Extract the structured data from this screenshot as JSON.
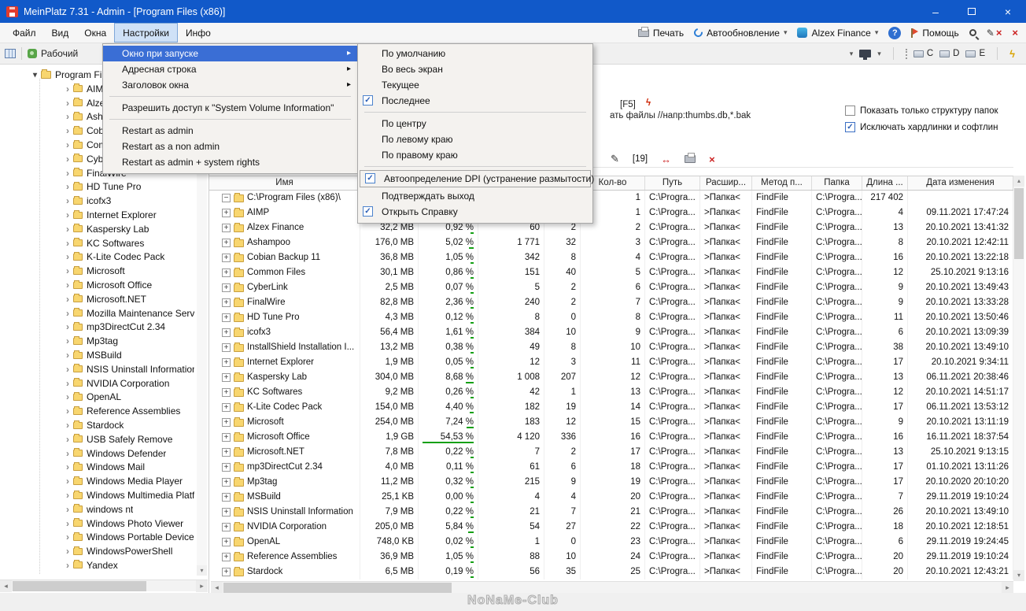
{
  "window": {
    "title": "MeinPlatz 7.31 - Admin - [Program Files (x86)]",
    "controls": {
      "minimize": "–",
      "close": "×"
    }
  },
  "menubar": {
    "items": [
      "Файл",
      "Вид",
      "Окна",
      "Настройки",
      "Инфо"
    ],
    "active": "Настройки",
    "right": {
      "print": "Печать",
      "autoupdate": "Автообновление",
      "alzex": "Alzex Finance",
      "help_mark": "?",
      "help": "Помощь"
    }
  },
  "toolbar2": {
    "workspace": "Рабочий",
    "drives": [
      "C",
      "D",
      "E"
    ]
  },
  "settings_menu": {
    "items": [
      {
        "label": "Окно при запуске",
        "arrow": true,
        "highlighted": true
      },
      {
        "label": "Адресная строка",
        "arrow": true
      },
      {
        "label": "Заголовок окна",
        "arrow": true
      },
      {
        "sep": true
      },
      {
        "label": "Разрешить доступ к \"System Volume Information\""
      },
      {
        "sep": true
      },
      {
        "label": "Restart as admin"
      },
      {
        "label": "Restart as a non admin"
      },
      {
        "label": "Restart as admin + system rights"
      }
    ]
  },
  "startup_submenu": {
    "items": [
      {
        "label": "По умолчанию"
      },
      {
        "label": "Во весь экран"
      },
      {
        "label": "Текущее"
      },
      {
        "label": "Последнее",
        "checked": true
      },
      {
        "sep": true
      },
      {
        "label": "По центру"
      },
      {
        "label": "По левому  краю"
      },
      {
        "label": "По правому  краю"
      },
      {
        "sep": true
      },
      {
        "label": "Автоопределение DPI (устранение размытости)",
        "checked": true,
        "boxed": true
      },
      {
        "label": "Подтверждать выход"
      },
      {
        "label": "Открыть Справку",
        "checked": true
      }
    ]
  },
  "sidebar": {
    "root": "Program Files (x86)",
    "items": [
      "AIMP",
      "Alzex Finance",
      "Ashampoo",
      "Cobian Backup 11",
      "Common Files",
      "CyberLink",
      "FinalWire",
      "HD Tune Pro",
      "icofx3",
      "Internet Explorer",
      "Kaspersky Lab",
      "KC Softwares",
      "K-Lite Codec Pack",
      "Microsoft",
      "Microsoft Office",
      "Microsoft.NET",
      "Mozilla Maintenance Servic",
      "mp3DirectCut 2.34",
      "Mp3tag",
      "MSBuild",
      "NSIS Uninstall Information",
      "NVIDIA Corporation",
      "OpenAL",
      "Reference Assemblies",
      "Stardock",
      "USB Safely Remove",
      "Windows Defender",
      "Windows Mail",
      "Windows Media Player",
      "Windows Multimedia Platfo",
      "windows nt",
      "Windows Photo Viewer",
      "Windows Portable Devices",
      "WindowsPowerShell",
      "Yandex"
    ]
  },
  "options_panel": {
    "refresh_hint": "[F5]",
    "exclude_hint": "ать файлы //напр:thumbs.db,*.bak",
    "checkboxes": [
      {
        "label": "Показать только структуру папок",
        "checked": false
      },
      {
        "label": "Исключать хардлинки и софтлин",
        "checked": true
      }
    ]
  },
  "table_toolbar": {
    "badge": "[19]"
  },
  "table": {
    "headers": [
      "Имя",
      "",
      "",
      "",
      "",
      "Кол-во",
      "Путь",
      "Расшир...",
      "Метод п...",
      "Папка",
      "Длина ...",
      "Дата изменения"
    ],
    "rows": [
      {
        "name": "C:\\Program Files (x86)\\",
        "root": true,
        "size": "",
        "pct": "",
        "files": "",
        "folders": "",
        "num": "1",
        "path": "C:\\Progra...",
        "ext": ">Папка<",
        "method": "FindFile",
        "folder": "C:\\Progra...",
        "len": "217 402",
        "date": ""
      },
      {
        "name": "AIMP",
        "size": "",
        "pct": "",
        "files": "",
        "folders": "",
        "num": "1",
        "path": "C:\\Progra...",
        "ext": ">Папка<",
        "method": "FindFile",
        "folder": "C:\\Progra...",
        "len": "4",
        "date": "09.11.2021 17:47:24"
      },
      {
        "name": "Alzex Finance",
        "size": "32,2 MB",
        "pct": "0,92 %",
        "files": "60",
        "folders": "2",
        "num": "2",
        "path": "C:\\Progra...",
        "ext": ">Папка<",
        "method": "FindFile",
        "folder": "C:\\Progra...",
        "len": "13",
        "date": "20.10.2021 13:41:32"
      },
      {
        "name": "Ashampoo",
        "size": "176,0 MB",
        "pct": "5,02 %",
        "files": "1 771",
        "folders": "32",
        "num": "3",
        "path": "C:\\Progra...",
        "ext": ">Папка<",
        "method": "FindFile",
        "folder": "C:\\Progra...",
        "len": "8",
        "date": "20.10.2021 12:42:11"
      },
      {
        "name": "Cobian Backup 11",
        "size": "36,8 MB",
        "pct": "1,05 %",
        "files": "342",
        "folders": "8",
        "num": "4",
        "path": "C:\\Progra...",
        "ext": ">Папка<",
        "method": "FindFile",
        "folder": "C:\\Progra...",
        "len": "16",
        "date": "20.10.2021 13:22:18"
      },
      {
        "name": "Common Files",
        "size": "30,1 MB",
        "pct": "0,86 %",
        "files": "151",
        "folders": "40",
        "num": "5",
        "path": "C:\\Progra...",
        "ext": ">Папка<",
        "method": "FindFile",
        "folder": "C:\\Progra...",
        "len": "12",
        "date": "25.10.2021 9:13:16"
      },
      {
        "name": "CyberLink",
        "size": "2,5 MB",
        "pct": "0,07 %",
        "files": "5",
        "folders": "2",
        "num": "6",
        "path": "C:\\Progra...",
        "ext": ">Папка<",
        "method": "FindFile",
        "folder": "C:\\Progra...",
        "len": "9",
        "date": "20.10.2021 13:49:43"
      },
      {
        "name": "FinalWire",
        "size": "82,8 MB",
        "pct": "2,36 %",
        "files": "240",
        "folders": "2",
        "num": "7",
        "path": "C:\\Progra...",
        "ext": ">Папка<",
        "method": "FindFile",
        "folder": "C:\\Progra...",
        "len": "9",
        "date": "20.10.2021 13:33:28"
      },
      {
        "name": "HD Tune Pro",
        "size": "4,3 MB",
        "pct": "0,12 %",
        "files": "8",
        "folders": "0",
        "num": "8",
        "path": "C:\\Progra...",
        "ext": ">Папка<",
        "method": "FindFile",
        "folder": "C:\\Progra...",
        "len": "11",
        "date": "20.10.2021 13:50:46"
      },
      {
        "name": "icofx3",
        "size": "56,4 MB",
        "pct": "1,61 %",
        "files": "384",
        "folders": "10",
        "num": "9",
        "path": "C:\\Progra...",
        "ext": ">Папка<",
        "method": "FindFile",
        "folder": "C:\\Progra...",
        "len": "6",
        "date": "20.10.2021 13:09:39"
      },
      {
        "name": "InstallShield Installation I...",
        "size": "13,2 MB",
        "pct": "0,38 %",
        "files": "49",
        "folders": "8",
        "num": "10",
        "path": "C:\\Progra...",
        "ext": ">Папка<",
        "method": "FindFile",
        "folder": "C:\\Progra...",
        "len": "38",
        "date": "20.10.2021 13:49:10"
      },
      {
        "name": "Internet Explorer",
        "size": "1,9 MB",
        "pct": "0,05 %",
        "files": "12",
        "folders": "3",
        "num": "11",
        "path": "C:\\Progra...",
        "ext": ">Папка<",
        "method": "FindFile",
        "folder": "C:\\Progra...",
        "len": "17",
        "date": "20.10.2021 9:34:11"
      },
      {
        "name": "Kaspersky Lab",
        "size": "304,0 MB",
        "pct": "8,68 %",
        "files": "1 008",
        "folders": "207",
        "num": "12",
        "path": "C:\\Progra...",
        "ext": ">Папка<",
        "method": "FindFile",
        "folder": "C:\\Progra...",
        "len": "13",
        "date": "06.11.2021 20:38:46"
      },
      {
        "name": "KC Softwares",
        "size": "9,2 MB",
        "pct": "0,26 %",
        "files": "42",
        "folders": "1",
        "num": "13",
        "path": "C:\\Progra...",
        "ext": ">Папка<",
        "method": "FindFile",
        "folder": "C:\\Progra...",
        "len": "12",
        "date": "20.10.2021 14:51:17"
      },
      {
        "name": "K-Lite Codec Pack",
        "size": "154,0 MB",
        "pct": "4,40 %",
        "files": "182",
        "folders": "19",
        "num": "14",
        "path": "C:\\Progra...",
        "ext": ">Папка<",
        "method": "FindFile",
        "folder": "C:\\Progra...",
        "len": "17",
        "date": "06.11.2021 13:53:12"
      },
      {
        "name": "Microsoft",
        "size": "254,0 MB",
        "pct": "7,24 %",
        "files": "183",
        "folders": "12",
        "num": "15",
        "path": "C:\\Progra...",
        "ext": ">Папка<",
        "method": "FindFile",
        "folder": "C:\\Progra...",
        "len": "9",
        "date": "20.10.2021 13:11:19"
      },
      {
        "name": "Microsoft Office",
        "size": "1,9 GB",
        "pct": "54,53 %",
        "files": "4 120",
        "folders": "336",
        "num": "16",
        "path": "C:\\Progra...",
        "ext": ">Папка<",
        "method": "FindFile",
        "folder": "C:\\Progra...",
        "len": "16",
        "date": "16.11.2021 18:37:54"
      },
      {
        "name": "Microsoft.NET",
        "size": "7,8 MB",
        "pct": "0,22 %",
        "files": "7",
        "folders": "2",
        "num": "17",
        "path": "C:\\Progra...",
        "ext": ">Папка<",
        "method": "FindFile",
        "folder": "C:\\Progra...",
        "len": "13",
        "date": "25.10.2021 9:13:15"
      },
      {
        "name": "mp3DirectCut 2.34",
        "size": "4,0 MB",
        "pct": "0,11 %",
        "files": "61",
        "folders": "6",
        "num": "18",
        "path": "C:\\Progra...",
        "ext": ">Папка<",
        "method": "FindFile",
        "folder": "C:\\Progra...",
        "len": "17",
        "date": "01.10.2021 13:11:26"
      },
      {
        "name": "Mp3tag",
        "size": "11,2 MB",
        "pct": "0,32 %",
        "files": "215",
        "folders": "9",
        "num": "19",
        "path": "C:\\Progra...",
        "ext": ">Папка<",
        "method": "FindFile",
        "folder": "C:\\Progra...",
        "len": "17",
        "date": "20.10.2020 20:10:20"
      },
      {
        "name": "MSBuild",
        "size": "25,1 KB",
        "pct": "0,00 %",
        "files": "4",
        "folders": "4",
        "num": "20",
        "path": "C:\\Progra...",
        "ext": ">Папка<",
        "method": "FindFile",
        "folder": "C:\\Progra...",
        "len": "7",
        "date": "29.11.2019 19:10:24"
      },
      {
        "name": "NSIS Uninstall Information",
        "size": "7,9 MB",
        "pct": "0,22 %",
        "files": "21",
        "folders": "7",
        "num": "21",
        "path": "C:\\Progra...",
        "ext": ">Папка<",
        "method": "FindFile",
        "folder": "C:\\Progra...",
        "len": "26",
        "date": "20.10.2021 13:49:10"
      },
      {
        "name": "NVIDIA Corporation",
        "size": "205,0 MB",
        "pct": "5,84 %",
        "files": "54",
        "folders": "27",
        "num": "22",
        "path": "C:\\Progra...",
        "ext": ">Папка<",
        "method": "FindFile",
        "folder": "C:\\Progra...",
        "len": "18",
        "date": "20.10.2021 12:18:51"
      },
      {
        "name": "OpenAL",
        "size": "748,0 KB",
        "pct": "0,02 %",
        "files": "1",
        "folders": "0",
        "num": "23",
        "path": "C:\\Progra...",
        "ext": ">Папка<",
        "method": "FindFile",
        "folder": "C:\\Progra...",
        "len": "6",
        "date": "29.11.2019 19:24:45"
      },
      {
        "name": "Reference Assemblies",
        "size": "36,9 MB",
        "pct": "1,05 %",
        "files": "88",
        "folders": "10",
        "num": "24",
        "path": "C:\\Progra...",
        "ext": ">Папка<",
        "method": "FindFile",
        "folder": "C:\\Progra...",
        "len": "20",
        "date": "29.11.2019 19:10:24"
      },
      {
        "name": "Stardock",
        "size": "6,5 MB",
        "pct": "0,19 %",
        "files": "56",
        "folders": "35",
        "num": "25",
        "path": "C:\\Progra...",
        "ext": ">Папка<",
        "method": "FindFile",
        "folder": "C:\\Progra...",
        "len": "20",
        "date": "20.10.2021 12:43:21"
      }
    ]
  },
  "watermark": "NoNaMe-Club"
}
